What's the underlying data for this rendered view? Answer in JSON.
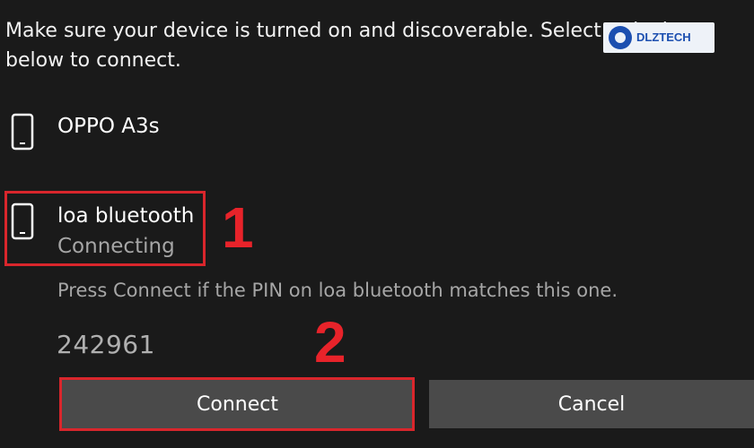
{
  "dialog": {
    "instruction": "Make sure your device is turned on and discoverable. Select a device below to connect."
  },
  "devices": [
    {
      "name": "OPPO A3s",
      "status": "",
      "icon": "phone-icon"
    },
    {
      "name": "loa bluetooth",
      "status": "Connecting",
      "icon": "phone-icon"
    }
  ],
  "pairing": {
    "message": "Press Connect if the PIN on loa bluetooth matches this one.",
    "pin": "242961"
  },
  "buttons": {
    "connect": "Connect",
    "cancel": "Cancel"
  },
  "annotations": {
    "step1": "1",
    "step2": "2",
    "highlight_color": "#d9262c"
  },
  "watermark": {
    "title": "DLZTECH"
  },
  "colors": {
    "background": "#1a1a1a",
    "button": "#4a4a4a",
    "secondary_text": "#a6a6a6"
  }
}
